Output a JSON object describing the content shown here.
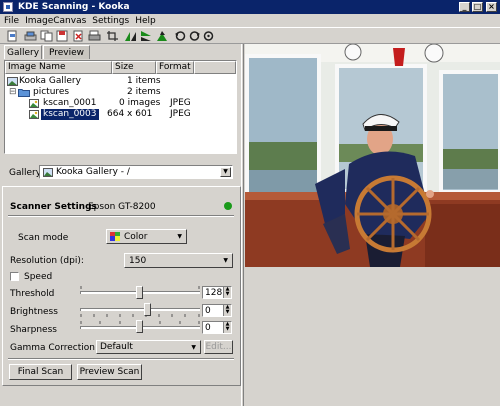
{
  "window": {
    "title": "KDE Scanning - Kooka"
  },
  "menu": [
    "File",
    "ImageCanvas",
    "Settings",
    "Help"
  ],
  "tabs": [
    {
      "label": "Gallery"
    },
    {
      "label": "Preview"
    }
  ],
  "tree": {
    "columns": [
      "Image Name",
      "Size",
      "Format"
    ],
    "rows": [
      {
        "name": "Kooka Gallery",
        "size": "1 items",
        "format": ""
      },
      {
        "name": "pictures",
        "size": "2 items",
        "format": ""
      },
      {
        "name": "kscan_0001",
        "size": "0 images",
        "format": "JPEG"
      },
      {
        "name": "kscan_0003",
        "size": "664 x 601",
        "format": "JPEG"
      }
    ]
  },
  "gallery": {
    "label": "Gallery",
    "value": "Kooka Gallery - /"
  },
  "scanner": {
    "title": "Scanner Settings",
    "device": "Epson GT-8200",
    "status_color": "#1a9a1a",
    "scan_mode_label": "Scan mode",
    "scan_mode_value": "Color",
    "resolution_label": "Resolution (dpi):",
    "resolution_value": "150",
    "speed_label": "Speed",
    "threshold_label": "Threshold",
    "threshold_value": "128",
    "brightness_label": "Brightness",
    "brightness_value": "0",
    "sharpness_label": "Sharpness",
    "sharpness_value": "0",
    "gamma_label": "Gamma Correction",
    "gamma_value": "Default",
    "edit_label": "Edit..."
  },
  "buttons": {
    "final_scan": "Final Scan",
    "preview_scan": "Preview Scan"
  }
}
